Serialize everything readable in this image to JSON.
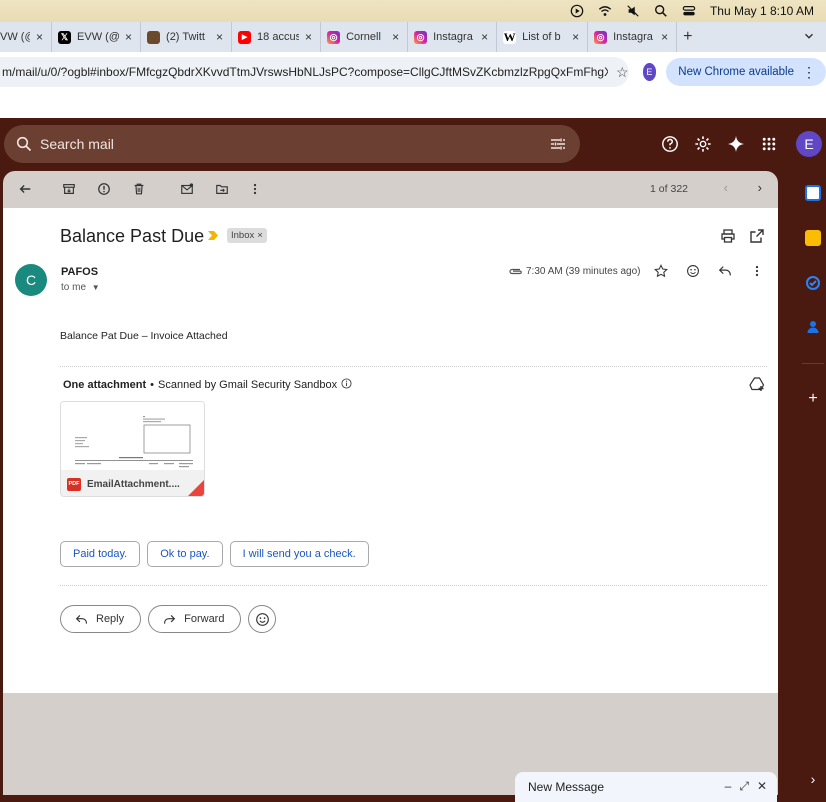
{
  "menubar": {
    "datetime": "Thu May 1  8:10 AM"
  },
  "tabs": [
    {
      "title": "VW (@",
      "favicon": "x-logo-icon",
      "color": "#000000"
    },
    {
      "title": "EVW (@",
      "favicon": "x-logo-icon",
      "color": "#000000"
    },
    {
      "title": "(2) Twitt",
      "favicon": "twitter-avatar-icon",
      "color": "#6b4a2b"
    },
    {
      "title": "18 accus",
      "favicon": "youtube-icon",
      "color": "#ff0000"
    },
    {
      "title": "Cornell",
      "favicon": "instagram-icon",
      "color": "#d6249f"
    },
    {
      "title": "Instagra",
      "favicon": "instagram-icon",
      "color": "#d6249f"
    },
    {
      "title": "List of b",
      "favicon": "wikipedia-icon",
      "color": "#ffffff"
    },
    {
      "title": "Instagra",
      "favicon": "instagram-icon",
      "color": "#d6249f"
    }
  ],
  "address": {
    "url": "m/mail/u/0/?ogbl#inbox/FMfcgzQbdrXKvvdTtmJVrswsHbNLJsPC?compose=CllgCJftMSvZKcbmzlzRpgQxFmFhgX...",
    "profile_initial": "E",
    "update_label": "New Chrome available"
  },
  "gmail": {
    "search_placeholder": "Search mail",
    "account_initial": "E",
    "pager": "1 of 322"
  },
  "email": {
    "subject": "Balance Past Due",
    "label": "Inbox",
    "label_close": "×",
    "sender_initial": "C",
    "sender": "PAFOS",
    "to": "to me",
    "time": "7:30 AM (39 minutes ago)",
    "body": "Balance Pat Due – Invoice Attached",
    "attachment_count": "One attachment",
    "scan_note": "Scanned by Gmail Security Sandbox",
    "attachment_name": "EmailAttachment....",
    "pdf_label": "PDF"
  },
  "smart_replies": [
    "Paid today.",
    "Ok to pay.",
    "I will send you a check."
  ],
  "actions": {
    "reply": "Reply",
    "forward": "Forward"
  },
  "compose": {
    "title": "New Message"
  },
  "colors": {
    "gmail_bg": "#4a1a10",
    "accent_blue": "#1a56c4",
    "avatar_purple": "#5f47c5",
    "sender_teal": "#1a8a7e"
  }
}
